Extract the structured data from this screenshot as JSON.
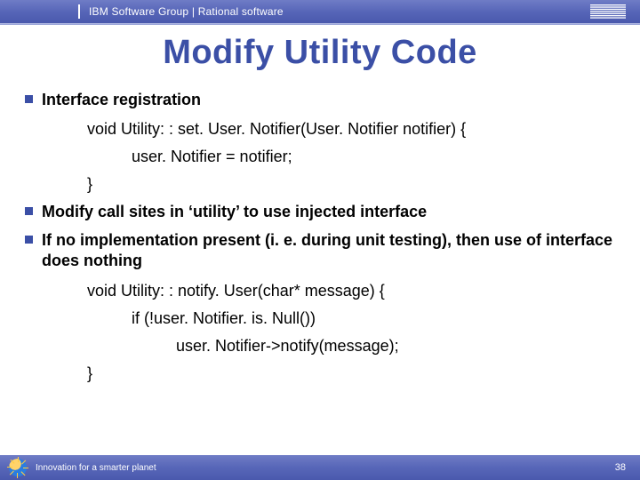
{
  "topbar": {
    "text": "IBM Software Group | Rational software",
    "logo_alt": "IBM"
  },
  "title": "Modify Utility Code",
  "bullets": {
    "b1": "Interface registration",
    "b2": "Modify call sites in ‘utility’ to use injected interface",
    "b3": "If no implementation present (i. e. during unit testing), then use of interface does nothing"
  },
  "code": {
    "c1": "void Utility: : set. User. Notifier(User. Notifier notifier) {",
    "c2": "user. Notifier = notifier;",
    "c3": "}",
    "c4": "void Utility: : notify. User(char* message) {",
    "c5": "if (!user. Notifier. is. Null())",
    "c6": "user. Notifier->notify(message);",
    "c7": "}"
  },
  "footer": {
    "tagline": "Innovation for a smarter planet",
    "page": "38"
  }
}
